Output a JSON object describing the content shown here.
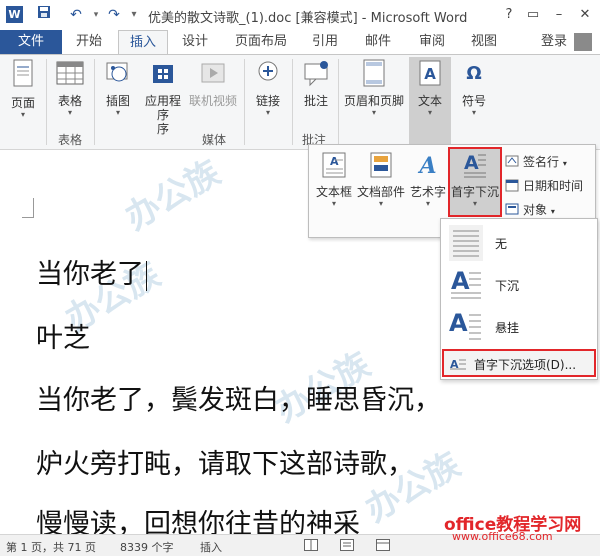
{
  "window": {
    "title": "优美的散文诗歌_(1).doc [兼容模式] - Microsoft Word",
    "controls": [
      "?",
      "▭",
      "–",
      "□",
      "✕"
    ]
  },
  "tabs": [
    "文件",
    "开始",
    "插入",
    "设计",
    "页面布局",
    "引用",
    "邮件",
    "审阅",
    "视图"
  ],
  "active_tab": "插入",
  "login": "登录",
  "ribbon": {
    "page": "页面",
    "table": "表格",
    "picture": "插图",
    "apps": "应用程序",
    "apps_line2": "序",
    "online_video": "联机视频",
    "link": "链接",
    "comment": "批注",
    "header_footer": "页眉和页脚",
    "text": "文本",
    "symbol": "符号",
    "group_table": "表格",
    "group_media": "媒体",
    "group_comment": "批注"
  },
  "text_panel": {
    "textbox": "文本框",
    "quickparts": "文档部件",
    "wordart": "艺术字",
    "dropcap": "首字下沉",
    "signature": "签名行",
    "datetime": "日期和时间",
    "object": "对象"
  },
  "dropcap_menu": {
    "none": "无",
    "dropped": "下沉",
    "margin": "悬挂",
    "options": "首字下沉选项(D)..."
  },
  "document": {
    "lines": [
      "当你老了",
      "叶芝",
      "当你老了，鬓发斑白，睡思昏沉，",
      "炉火旁打盹，请取下这部诗歌，",
      "慢慢读，回想你往昔的神采"
    ]
  },
  "status": {
    "page": "第 1 页，共 71 页",
    "words": "8339 个字",
    "mode": "插入"
  },
  "watermark": {
    "site": "office教程学习网",
    "url": "www.office68.com"
  },
  "colors": {
    "word_blue": "#2b579a",
    "highlight_red": "#e2262a"
  }
}
